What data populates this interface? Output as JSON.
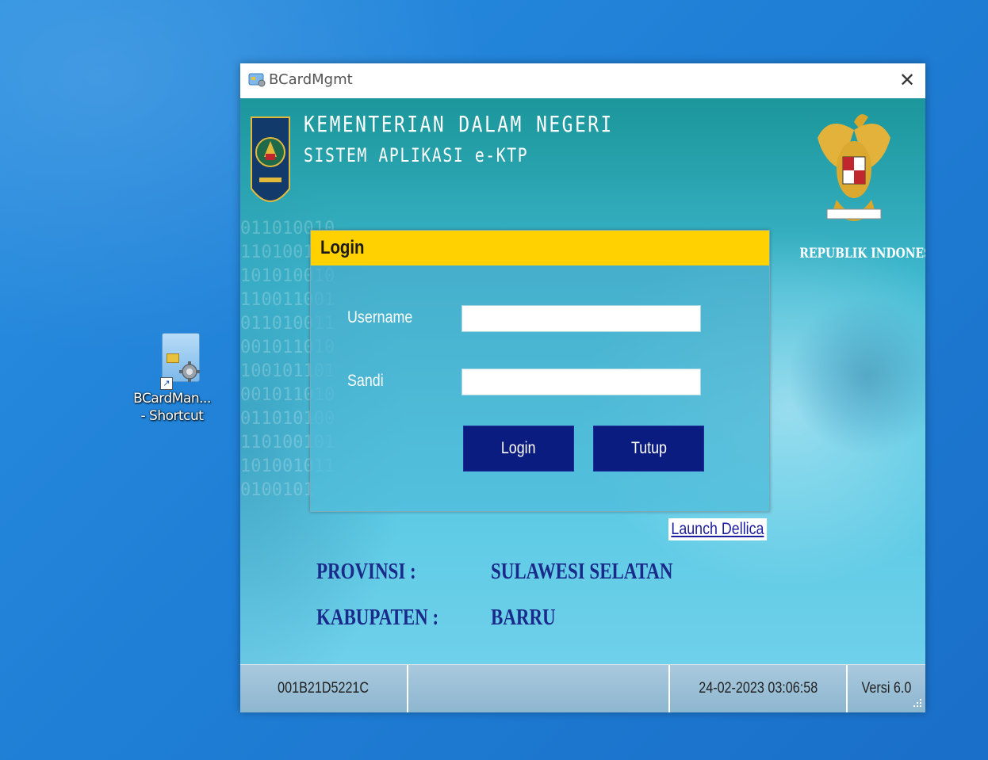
{
  "desktop": {
    "icon_label_line1": "BCardMan...",
    "icon_label_line2": "- Shortcut"
  },
  "window": {
    "title": "BCardMgmt",
    "close_glyph": "✕"
  },
  "header": {
    "line1": "KEMENTERIAN DALAM NEGERI",
    "line2": "SISTEM APLIKASI e-KTP",
    "republik": "REPUBLIK INDONESIA"
  },
  "login": {
    "title": "Login",
    "username_label": "Username",
    "username_value": "",
    "sandi_label": "Sandi",
    "sandi_value": "",
    "login_button": "Login",
    "tutup_button": "Tutup"
  },
  "launch_link": "Launch Dellica",
  "location": {
    "provinsi_label": "PROVINSI :",
    "provinsi_value": "SULAWESI SELATAN",
    "kabupaten_label": "KABUPATEN :",
    "kabupaten_value": "BARRU"
  },
  "status": {
    "device_id": "001B21D5221C",
    "middle": "",
    "datetime": "24-02-2023 03:06:58",
    "version": "Versi 6.0"
  },
  "colors": {
    "desktop": "#1f7fd6",
    "login_header": "#ffd100",
    "button": "#0b1c80",
    "info_text": "#1a2a8a"
  }
}
